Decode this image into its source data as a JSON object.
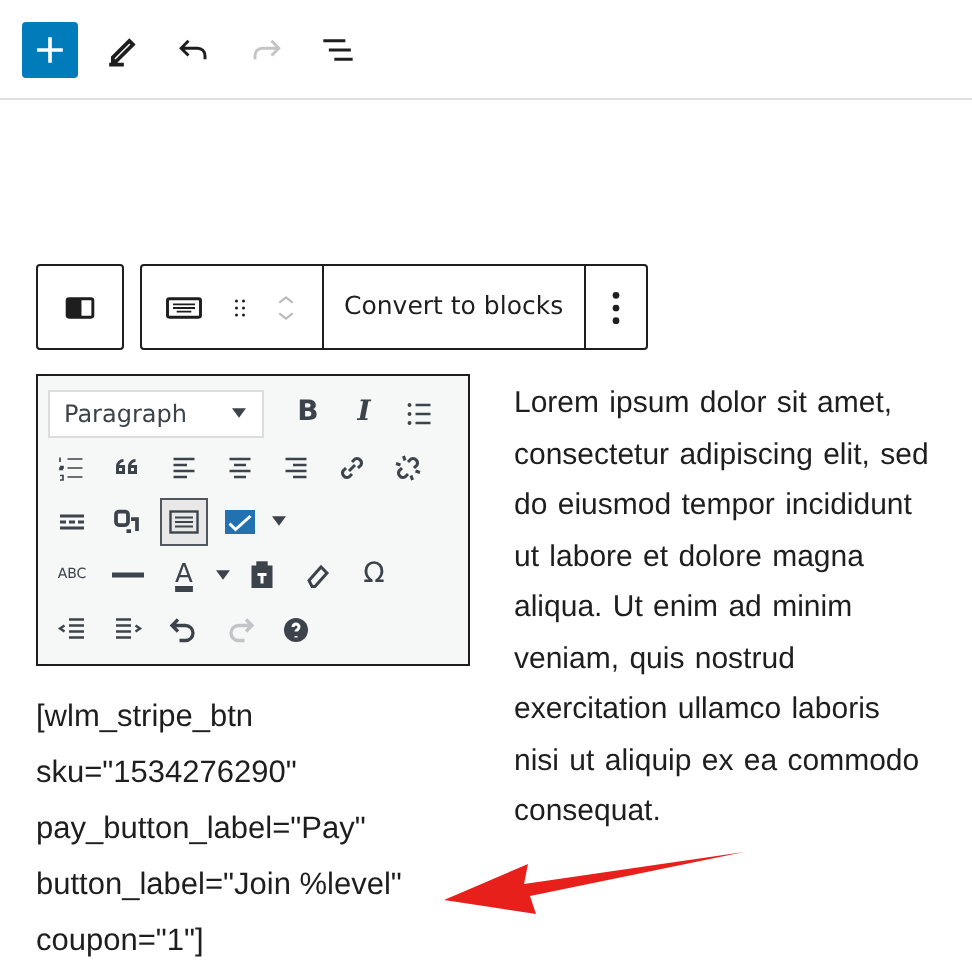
{
  "top_toolbar": [
    {
      "kind": "add",
      "disabled": false
    },
    {
      "kind": "pencil",
      "disabled": false
    },
    {
      "kind": "undo",
      "disabled": false
    },
    {
      "kind": "redo",
      "disabled": true
    },
    {
      "kind": "outline",
      "disabled": false
    }
  ],
  "block_toolbar": {
    "convert_label": "Convert to blocks"
  },
  "classic_toolbar": {
    "format_select": "Paragraph",
    "rows": [
      [
        {
          "kind": "bold",
          "label": "B"
        },
        {
          "kind": "italic",
          "label": "I"
        },
        {
          "kind": "bullets"
        }
      ],
      [
        {
          "kind": "numbers"
        },
        {
          "kind": "quote"
        },
        {
          "kind": "align-left"
        },
        {
          "kind": "align-center"
        },
        {
          "kind": "align-right"
        },
        {
          "kind": "link"
        },
        {
          "kind": "unlink"
        }
      ],
      [
        {
          "kind": "more"
        },
        {
          "kind": "media"
        },
        {
          "kind": "keyboard",
          "pressed": true
        },
        {
          "kind": "check"
        }
      ],
      [
        {
          "kind": "strike",
          "label": "ABC"
        },
        {
          "kind": "hr"
        },
        {
          "kind": "color",
          "label": "A"
        },
        {
          "kind": "paste"
        },
        {
          "kind": "eraser"
        },
        {
          "kind": "omega",
          "label": "Ω"
        }
      ],
      [
        {
          "kind": "outdent"
        },
        {
          "kind": "indent"
        },
        {
          "kind": "undo"
        },
        {
          "kind": "redo",
          "disabled": true
        },
        {
          "kind": "help"
        }
      ]
    ]
  },
  "shortcode_lines": [
    "[wlm_stripe_btn",
    "sku=\"1534276290\"",
    "pay_button_label=\"Pay\"",
    "button_label=\"Join %level\"",
    "coupon=\"1\"]"
  ],
  "paragraph": "Lorem ipsum dolor sit amet, consectetur adipiscing elit, sed do eiusmod tempor incididunt ut labore et dolore magna aliqua. Ut enim ad minim veniam, quis nostrud exercitation ullamco laboris nisi ut aliquip ex ea commodo consequat."
}
